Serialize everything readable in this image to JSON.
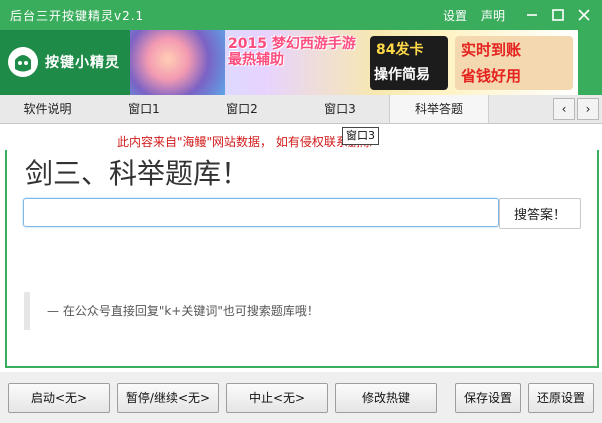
{
  "window": {
    "title": "后台三开按键精灵v2.1",
    "links": [
      "设置",
      "声明"
    ],
    "controls": [
      "minimize",
      "maximize",
      "close"
    ]
  },
  "logo": {
    "text": "按键小精灵"
  },
  "banner": {
    "game_text": "2015 梦幻西游手游 最热辅助",
    "card_top": "84发卡",
    "card_bottom": "操作简易",
    "promo_top": "实时到账",
    "promo_bottom": "省钱好用"
  },
  "tabs": [
    "软件说明",
    "窗口1",
    "窗口2",
    "窗口3",
    "科举答题"
  ],
  "active_tab": "科举答题",
  "tab_arrows": {
    "left": "‹",
    "right": "›"
  },
  "tooltip": "窗口3",
  "notice": "此内容来自\"海鳗\"网站数据， 如有侵权联系删除",
  "content": {
    "heading": "剑三、科举题库！",
    "search_value": "",
    "search_button": "搜答案！",
    "tip": "— 在公众号直接回复\"k+关键词\"也可搜索题库哦！"
  },
  "buttons": {
    "start": "启动<无>",
    "pause": "暂停/继续<无>",
    "stop": "中止<无>",
    "hotkey": "修改热键",
    "save": "保存设置",
    "restore": "还原设置"
  },
  "colors": {
    "accent": "#3aad5d",
    "notice": "#d21b1b"
  }
}
